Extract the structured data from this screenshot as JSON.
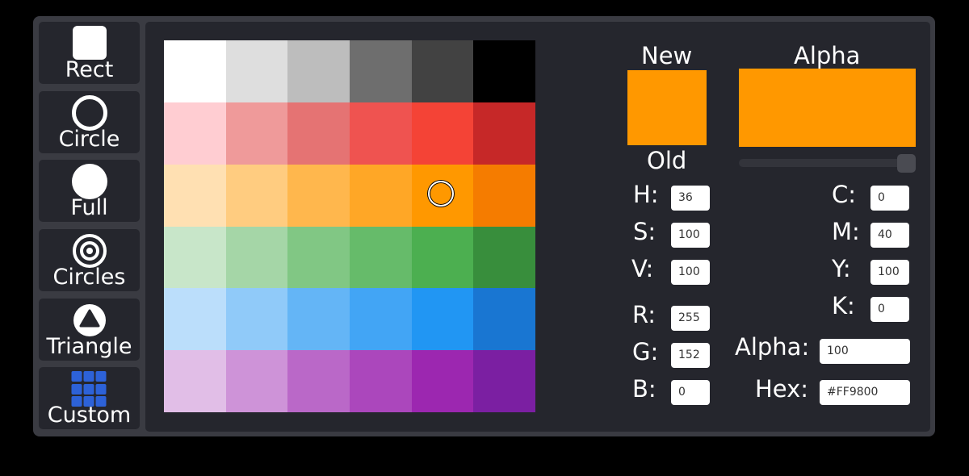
{
  "sidebar": {
    "items": [
      {
        "label": "Rect",
        "icon": "rect-icon"
      },
      {
        "label": "Circle",
        "icon": "circle-outline-icon"
      },
      {
        "label": "Full",
        "icon": "filled-circle-icon"
      },
      {
        "label": "Circles",
        "icon": "concentric-circles-icon"
      },
      {
        "label": "Triangle",
        "icon": "triangle-icon"
      },
      {
        "label": "Custom",
        "icon": "grid-icon"
      }
    ]
  },
  "palette": [
    [
      "#FFFFFF",
      "#DEDEDE",
      "#BDBDBD",
      "#6E6E6E",
      "#424242",
      "#000000"
    ],
    [
      "#FFCDD2",
      "#EF9A9A",
      "#E57373",
      "#EF5350",
      "#F44336",
      "#C62828"
    ],
    [
      "#FFE0B2",
      "#FFCC80",
      "#FFB74D",
      "#FFA726",
      "#FF9800",
      "#F57C00"
    ],
    [
      "#C8E6C9",
      "#A5D6A7",
      "#81C784",
      "#66BB6A",
      "#4CAF50",
      "#388E3C"
    ],
    [
      "#BBDEFB",
      "#90CAF9",
      "#64B5F6",
      "#42A5F5",
      "#2196F3",
      "#1976D2"
    ],
    [
      "#E1BEE7",
      "#CE93D8",
      "#BA68C8",
      "#AB47BC",
      "#9C27B0",
      "#7B1FA2"
    ]
  ],
  "selected_color": "#FF9800",
  "preview": {
    "new_label": "New",
    "old_label": "Old",
    "alpha_label": "Alpha",
    "new_color": "#FF9800",
    "alpha_color": "#FF9800"
  },
  "alpha_slider": {
    "value": 1.0
  },
  "hsv": {
    "h_label": "H:",
    "h_value": "36",
    "s_label": "S:",
    "s_value": "100",
    "v_label": "V:",
    "v_value": "100"
  },
  "rgb": {
    "r_label": "R:",
    "r_value": "255",
    "g_label": "G:",
    "g_value": "152",
    "b_label": "B:",
    "b_value": "0"
  },
  "cmyk": {
    "c_label": "C:",
    "c_value": "0",
    "m_label": "M:",
    "m_value": "40",
    "y_label": "Y:",
    "y_value": "100",
    "k_label": "K:",
    "k_value": "0"
  },
  "alpha_field": {
    "label": "Alpha:",
    "value": "100"
  },
  "hex_field": {
    "label": "Hex:",
    "value": "#FF9800"
  }
}
